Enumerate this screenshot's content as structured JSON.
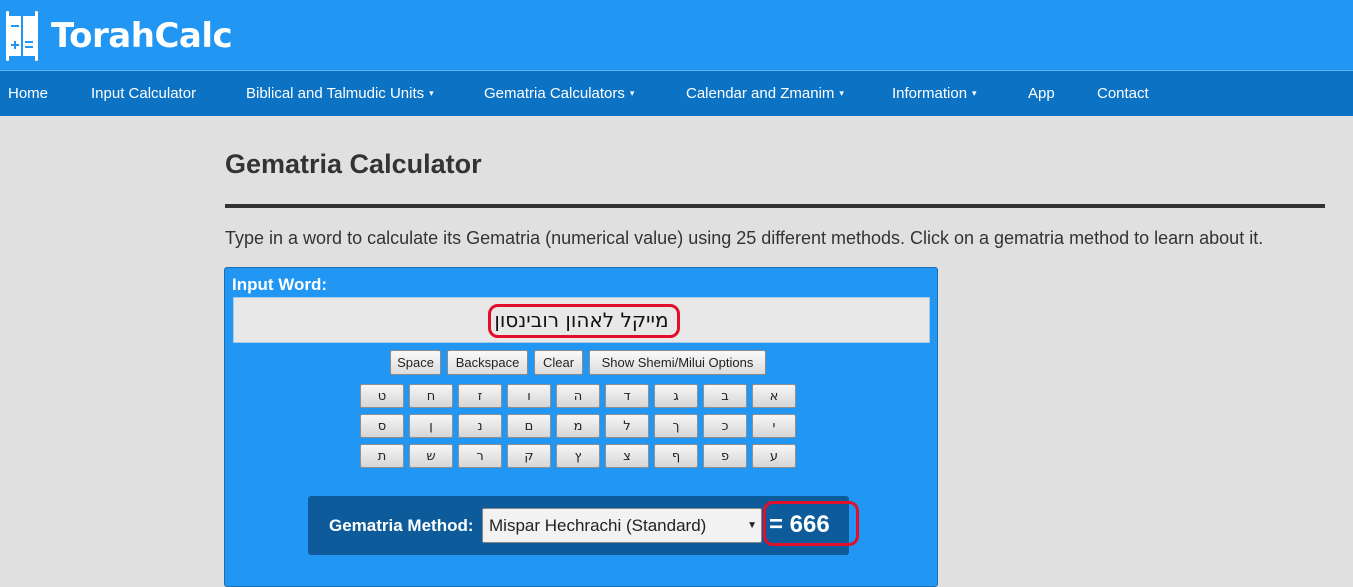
{
  "brand": "TorahCalc",
  "nav": {
    "home": "Home",
    "input_calculator": "Input Calculator",
    "units": "Biblical and Talmudic Units",
    "gematria": "Gematria Calculators",
    "calendar": "Calendar and Zmanim",
    "information": "Information",
    "app": "App",
    "contact": "Contact",
    "caret": "▾"
  },
  "page": {
    "title": "Gematria Calculator",
    "intro": "Type in a word to calculate its Gematria (numerical value) using 25 different methods. Click on a gematria method to learn about it."
  },
  "calculator": {
    "input_label": "Input Word:",
    "input_value": "מייקל לאהון רובינסון",
    "buttons": {
      "space": "Space",
      "backspace": "Backspace",
      "clear": "Clear",
      "shemi": "Show Shemi/Milui Options"
    },
    "keys": {
      "row1": [
        "א",
        "ב",
        "ג",
        "ד",
        "ה",
        "ו",
        "ז",
        "ח",
        "ט"
      ],
      "row2": [
        "י",
        "כ",
        "ך",
        "ל",
        "מ",
        "ם",
        "נ",
        "ן",
        "ס"
      ],
      "row3": [
        "ע",
        "פ",
        "ף",
        "צ",
        "ץ",
        "ק",
        "ר",
        "ש",
        "ת"
      ]
    },
    "method_label": "Gematria Method:",
    "method_selected": "Mispar Hechrachi (Standard)",
    "result": "= 666"
  },
  "colors": {
    "header": "#2196f3",
    "nav": "#0b72c4",
    "method_box": "#0d5b9a",
    "highlight": "#e0102a"
  }
}
